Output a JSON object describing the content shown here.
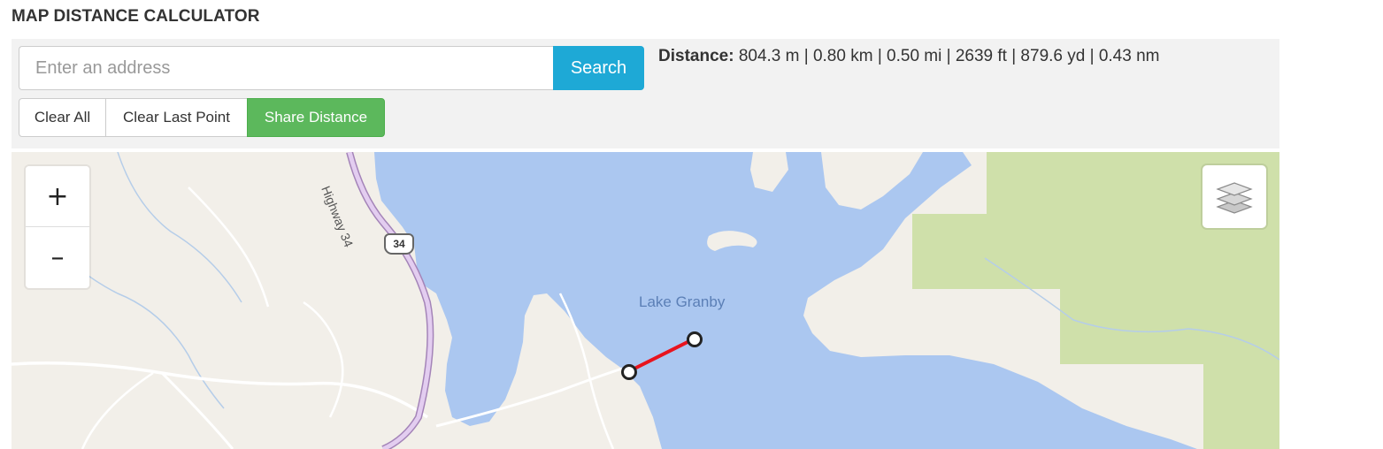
{
  "page": {
    "title": "MAP DISTANCE CALCULATOR"
  },
  "search": {
    "placeholder": "Enter an address",
    "button_label": "Search"
  },
  "actions": {
    "clear_all_label": "Clear All",
    "clear_last_point_label": "Clear Last Point",
    "share_distance_label": "Share Distance"
  },
  "distance": {
    "label": "Distance:",
    "value": "804.3 m | 0.80 km | 0.50 mi | 2639 ft | 879.6 yd | 0.43 nm"
  },
  "map": {
    "zoom_in_label": "+",
    "zoom_out_label": "–",
    "layers_icon": "layers-icon",
    "lake_label": "Lake Granby",
    "highway_label": "Highway 34",
    "highway_shield": "34",
    "colors": {
      "water": "#abc7f0",
      "land": "#f2efe9",
      "park": "#cfe0aa",
      "highway": "#c9a4d9",
      "route_line": "#e8141e",
      "search_button": "#1ea9d6",
      "share_button": "#5cb85c"
    }
  }
}
